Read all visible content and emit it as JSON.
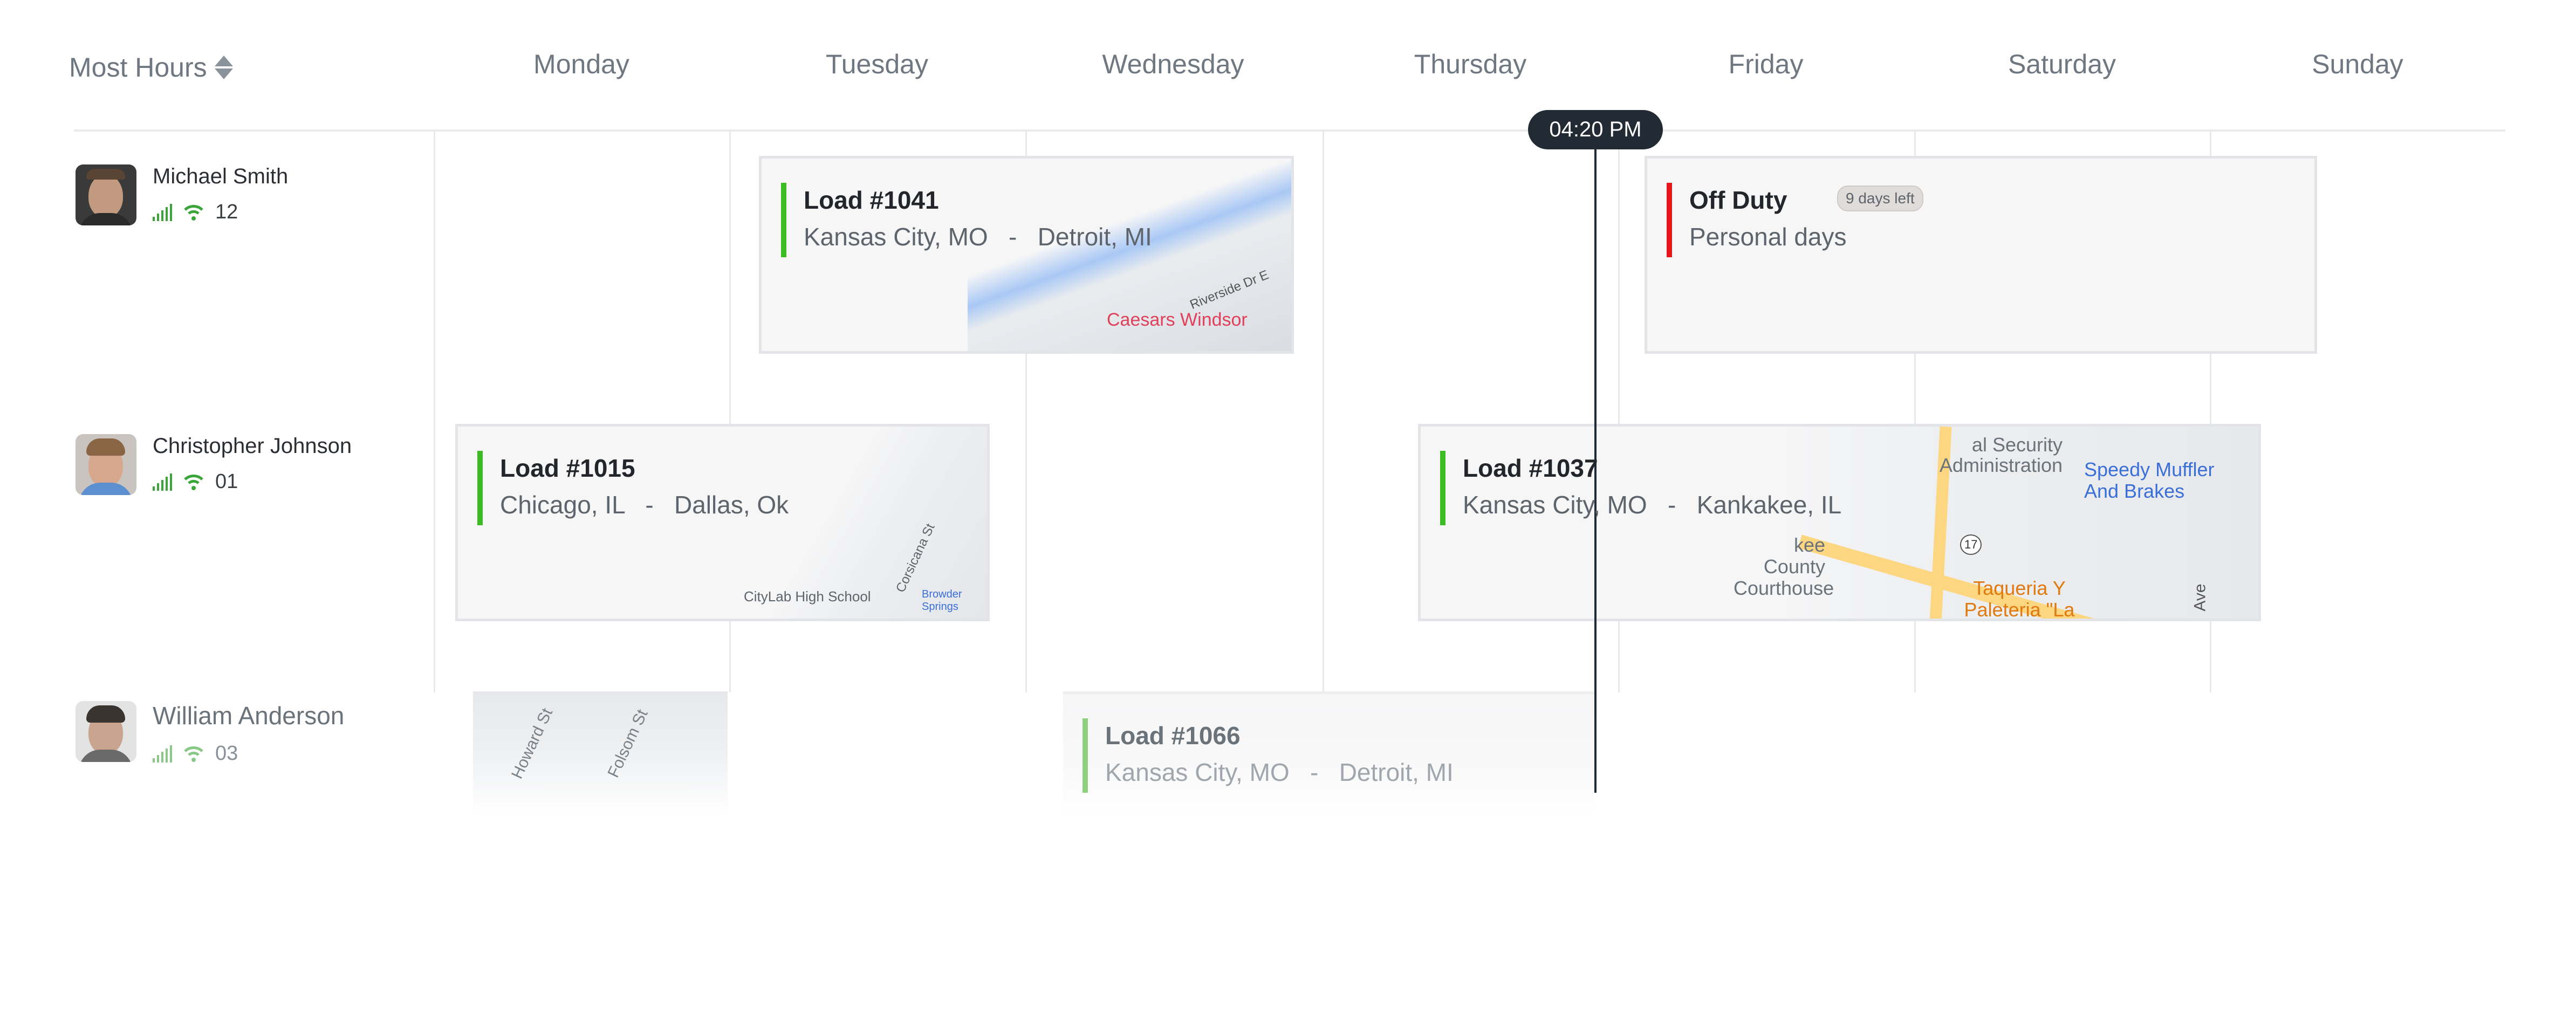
{
  "header": {
    "sort_label": "Most Hours",
    "sort_icon": "sort-up-down-icon",
    "days": [
      "Monday",
      "Tuesday",
      "Wednesday",
      "Thursday",
      "Friday",
      "Saturday",
      "Sunday"
    ]
  },
  "now_marker": {
    "time": "04:20 PM"
  },
  "colors": {
    "load_accent": "#3dbb23",
    "off_duty_accent": "#e8161b",
    "now_marker": "#222a33",
    "signal": "#3aa63a"
  },
  "drivers": [
    {
      "name": "Michael Smith",
      "count": "12",
      "signal_icon": "signal-bars-icon",
      "wifi_icon": "wifi-icon"
    },
    {
      "name": "Christopher Johnson",
      "count": "01",
      "signal_icon": "signal-bars-icon",
      "wifi_icon": "wifi-icon"
    },
    {
      "name": "William Anderson",
      "count": "03",
      "signal_icon": "signal-bars-icon",
      "wifi_icon": "wifi-icon"
    }
  ],
  "events": [
    {
      "title": "Load #1041",
      "from": "Kansas City, MO",
      "to": "Detroit, MI",
      "type": "load",
      "map_labels": [
        "Caesars Windsor",
        "Riverside Dr E"
      ]
    },
    {
      "title": "Off Duty",
      "subtitle": "Personal days",
      "badge": "9 days left",
      "type": "off_duty"
    },
    {
      "title": "Load #1015",
      "from": "Chicago, IL",
      "to": "Dallas, Ok",
      "type": "load",
      "map_labels": [
        "CityLab High School",
        "Corsicana St",
        "Browder Springs"
      ]
    },
    {
      "title": "Load #1037",
      "from": "Kansas City, MO",
      "to": "Kankakee, IL",
      "type": "load",
      "map_labels": [
        "al Security Administration",
        "Speedy Muffler And Brakes",
        "kee County Courthouse",
        "Taqueria Y Paleteria \"La Michoacana\"",
        "17",
        "Ave"
      ]
    },
    {
      "title": "Load #1066",
      "from": "Kansas City, MO",
      "to": "Detroit, MI",
      "type": "load"
    }
  ],
  "partial_map_labels": [
    "Howard St",
    "Folsom St"
  ]
}
